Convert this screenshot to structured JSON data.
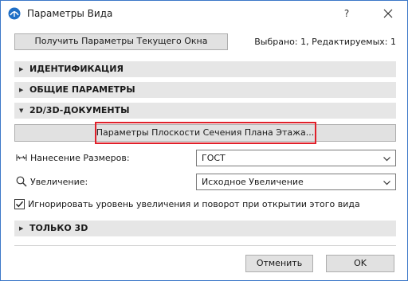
{
  "window": {
    "title": "Параметры Вида",
    "help_label": "?",
    "close_icon": "close-icon",
    "app_icon": "archicad-icon",
    "accent_color": "#3c78c8"
  },
  "top": {
    "get_params_button": "Получить Параметры Текущего Окна",
    "selection_info": "Выбрано: 1, Редактируемых: 1"
  },
  "sections": [
    {
      "label": "ИДЕНТИФИКАЦИЯ",
      "state": "collapsed"
    },
    {
      "label": "ОБЩИЕ ПАРАМЕТРЫ",
      "state": "collapsed"
    },
    {
      "label": "2D/3D-ДОКУМЕНТЫ",
      "state": "expanded"
    },
    {
      "label": "ТОЛЬКО 3D",
      "state": "collapsed"
    }
  ],
  "docs": {
    "floor_plan_cut_button": "Параметры Плоскости Сечения Плана Этажа...",
    "highlight_color": "#e0202a",
    "dimensioning": {
      "label": "Нанесение Размеров:",
      "value": "ГОСТ",
      "icon": "dimension-icon"
    },
    "zoom": {
      "label": "Увеличение:",
      "value": "Исходное Увеличение",
      "icon": "magnifier-icon"
    },
    "ignore_zoom": {
      "label": "Игнорировать уровень увеличения и поворот при открытии этого вида",
      "checked": true
    }
  },
  "footer": {
    "cancel_button": "Отменить",
    "ok_button": "OK"
  }
}
